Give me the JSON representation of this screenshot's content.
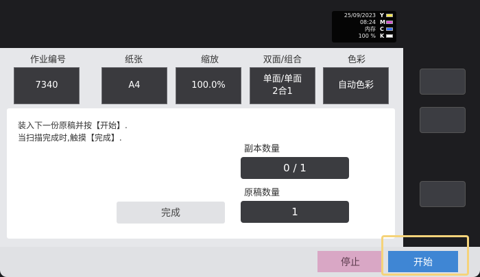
{
  "status": {
    "date": "25/09/2023",
    "time": "08:24",
    "memory_label": "内存",
    "memory_value": "100 %",
    "inks": [
      {
        "letter": "Y",
        "color": "#f5e64a"
      },
      {
        "letter": "M",
        "color": "#d44fd0"
      },
      {
        "letter": "C",
        "color": "#3a6ff0"
      },
      {
        "letter": "K",
        "color": "#ffffff"
      }
    ]
  },
  "settings": {
    "job_number": {
      "label": "作业编号",
      "value": "7340"
    },
    "paper": {
      "label": "纸张",
      "value": "A4"
    },
    "zoom": {
      "label": "缩放",
      "value": "100.0%"
    },
    "duplex": {
      "label": "双面/组合",
      "value_line1": "单面/单面",
      "value_line2": "2合1"
    },
    "color": {
      "label": "色彩",
      "value": "自动色彩"
    }
  },
  "messages": {
    "line1": "装入下一份原稿并按【开始】.",
    "line2": "当扫描完成时,触摸【完成】."
  },
  "copies": {
    "label": "副本数量",
    "value": "0 / 1"
  },
  "originals": {
    "label": "原稿数量",
    "value": "1"
  },
  "buttons": {
    "done": "完成",
    "stop": "停止",
    "start": "开始"
  }
}
